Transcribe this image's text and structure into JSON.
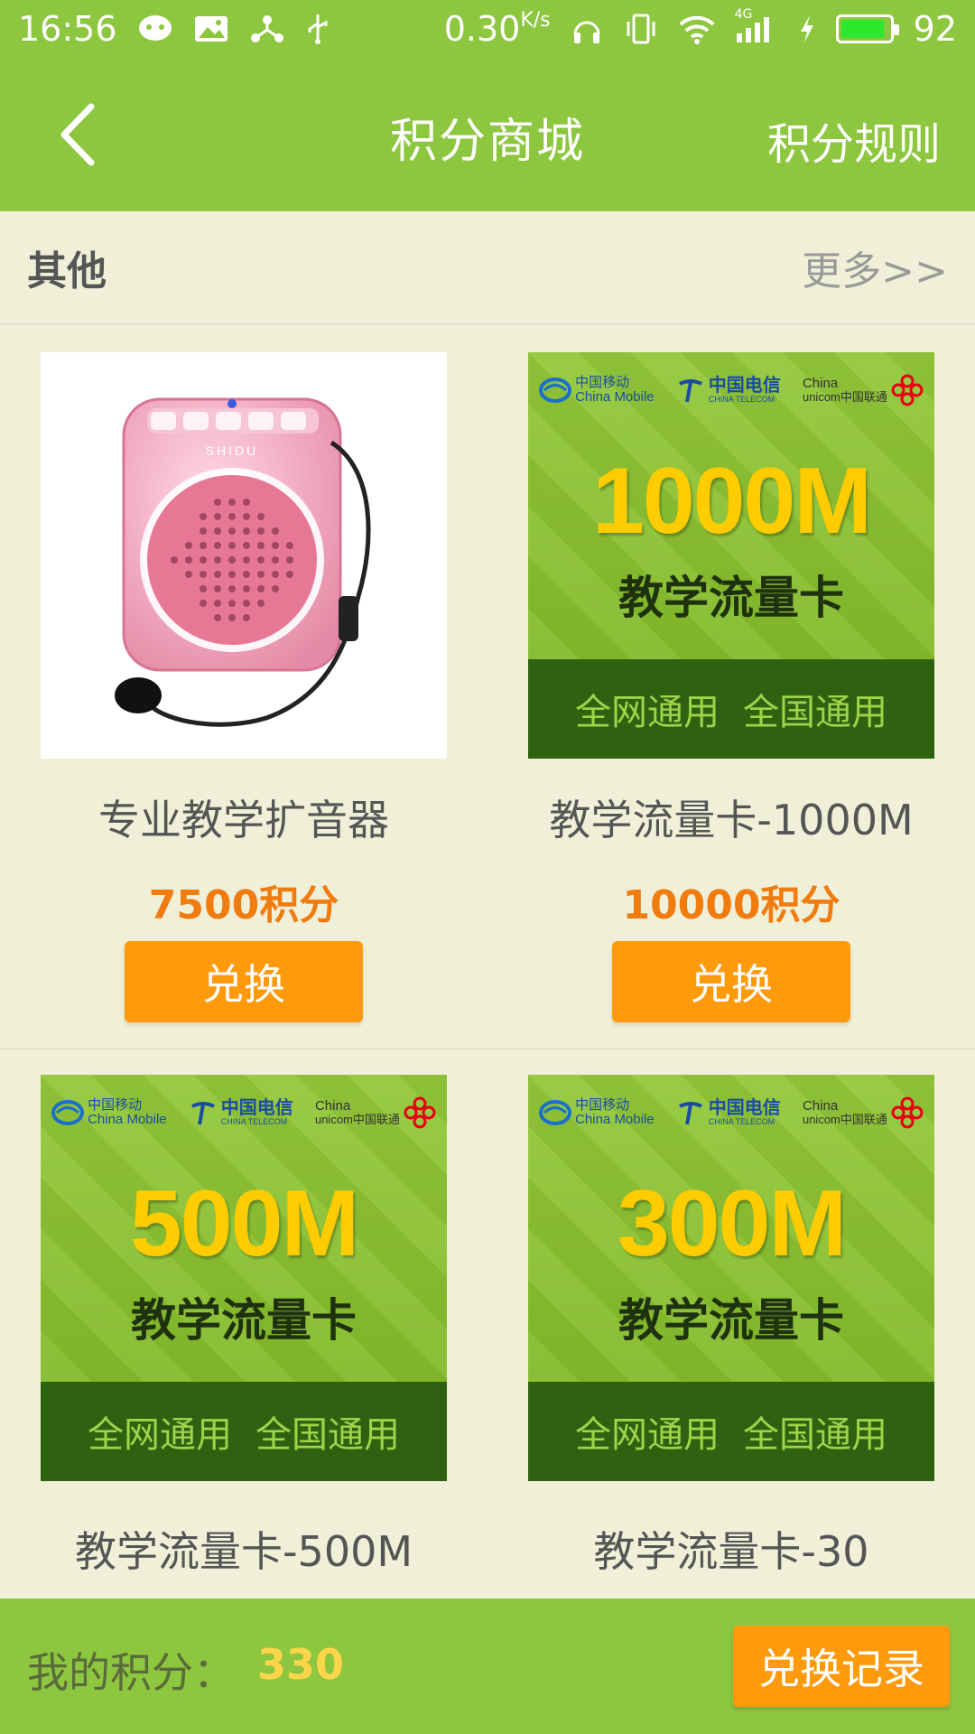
{
  "status_bar": {
    "time": "16:56",
    "network_speed": "0.30",
    "network_unit": "K/s",
    "battery_level": 92,
    "battery_text": "92",
    "signal_label": "4G"
  },
  "header": {
    "title": "积分商城",
    "rules_label": "积分规则"
  },
  "section": {
    "title": "其他",
    "more_label": "更多>>"
  },
  "products": [
    {
      "name": "专业教学扩音器",
      "points": "7500积分",
      "button_label": "兑换"
    },
    {
      "name": "教学流量卡-1000M",
      "points": "10000积分",
      "button_label": "兑换",
      "card": {
        "size": "1000M",
        "subtitle": "教学流量卡",
        "footer_a": "全网通用",
        "footer_b": "全国通用"
      }
    },
    {
      "name": "教学流量卡-500M",
      "card": {
        "size": "500M",
        "subtitle": "教学流量卡",
        "footer_a": "全网通用",
        "footer_b": "全国通用"
      }
    },
    {
      "name": "教学流量卡-30",
      "card": {
        "size": "300M",
        "subtitle": "教学流量卡",
        "footer_a": "全网通用",
        "footer_b": "全国通用"
      }
    }
  ],
  "carriers": {
    "mobile_cn": "中国移动",
    "mobile_en": "China Mobile",
    "telecom_cn": "中国电信",
    "telecom_en": "CHINA TELECOM",
    "unicom_en": "China",
    "unicom_cn": "unicom中国联通"
  },
  "speaker_brand": "SHIDU",
  "footer": {
    "my_points_label": "我的积分：",
    "my_points_value": "330",
    "history_label": "兑换记录"
  },
  "colors": {
    "brand_green": "#8dc63f",
    "accent_orange": "#ff9a0c",
    "points_orange": "#f07c10",
    "background": "#f0f0d8"
  }
}
